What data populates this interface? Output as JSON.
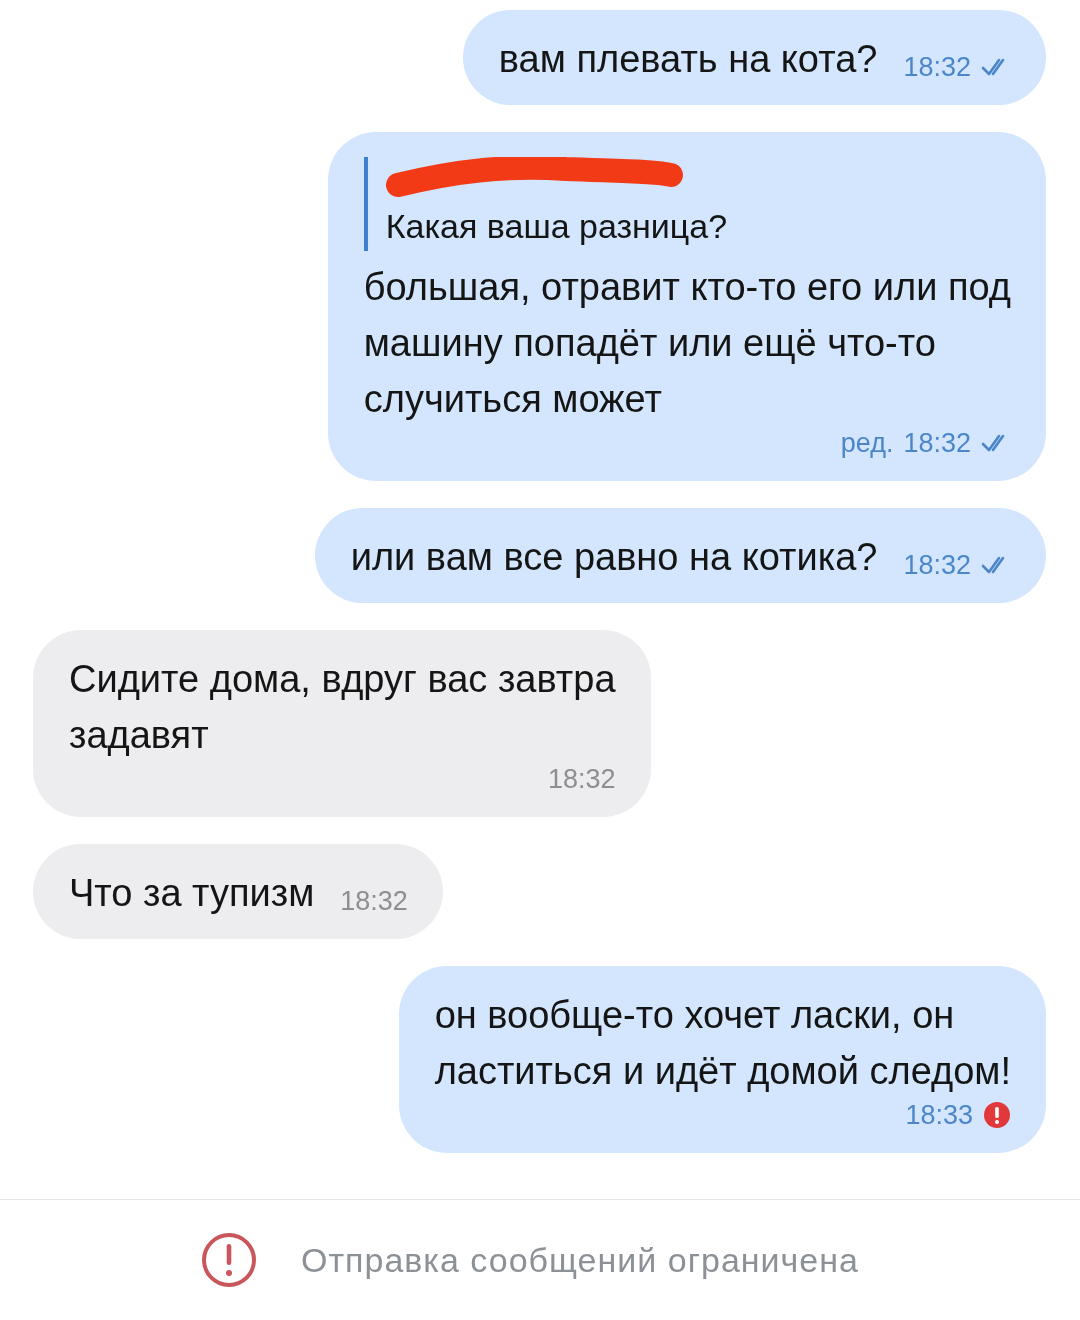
{
  "messages": [
    {
      "kind": "outgoing",
      "lines": [
        "вам плевать на кота?"
      ],
      "time": "18:32",
      "read": true,
      "error": false
    },
    {
      "kind": "outgoing",
      "reply": {
        "author_redacted": true,
        "text": "Какая ваша разница?"
      },
      "lines": [
        "большая, отравит кто-то его или под",
        "машину попадёт или ещё что-то",
        "случиться может"
      ],
      "edited": "ред.",
      "time": "18:32",
      "read": true,
      "error": false
    },
    {
      "kind": "outgoing",
      "lines": [
        "или вам все равно на котика?"
      ],
      "time": "18:32",
      "read": true,
      "error": false
    },
    {
      "kind": "incoming",
      "lines": [
        "Сидите дома, вдруг вас завтра",
        "задавят"
      ],
      "time": "18:32"
    },
    {
      "kind": "incoming",
      "lines": [
        "Что за тупизм"
      ],
      "time": "18:32"
    },
    {
      "kind": "outgoing",
      "lines": [
        "он вообще-то хочет ласки, он",
        "ластиться и идёт домой следом!"
      ],
      "time": "18:33",
      "error": true
    }
  ],
  "footer": {
    "notice": "Отправка сообщений ограничена"
  }
}
